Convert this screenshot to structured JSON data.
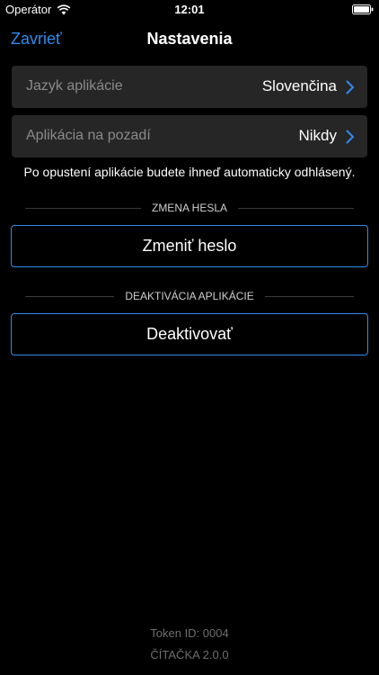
{
  "status_bar": {
    "carrier": "Operátor",
    "time": "12:01",
    "wifi_icon": "wifi-icon",
    "battery_icon": "battery-icon"
  },
  "nav": {
    "close_label": "Zavrieť",
    "title": "Nastavenia"
  },
  "settings": {
    "language": {
      "label": "Jazyk aplikácie",
      "value": "Slovenčina",
      "icon": "chevron-right-icon"
    },
    "background": {
      "label": "Aplikácia na pozadí",
      "value": "Nikdy",
      "icon": "chevron-right-icon"
    }
  },
  "info_text": "Po opustení aplikácie budete ihneď automaticky odhlásený.",
  "sections": {
    "password": {
      "header": "ZMENA HESLA",
      "button_label": "Zmeniť heslo"
    },
    "deactivate": {
      "header": "DEAKTIVÁCIA APLIKÁCIE",
      "button_label": "Deaktivovať"
    }
  },
  "footer": {
    "token": "Token ID: 0004",
    "version": "ČÍTAČKA 2.0.0"
  },
  "colors": {
    "accent": "#2f8cf0",
    "background": "#000000",
    "row_background": "#262626"
  }
}
